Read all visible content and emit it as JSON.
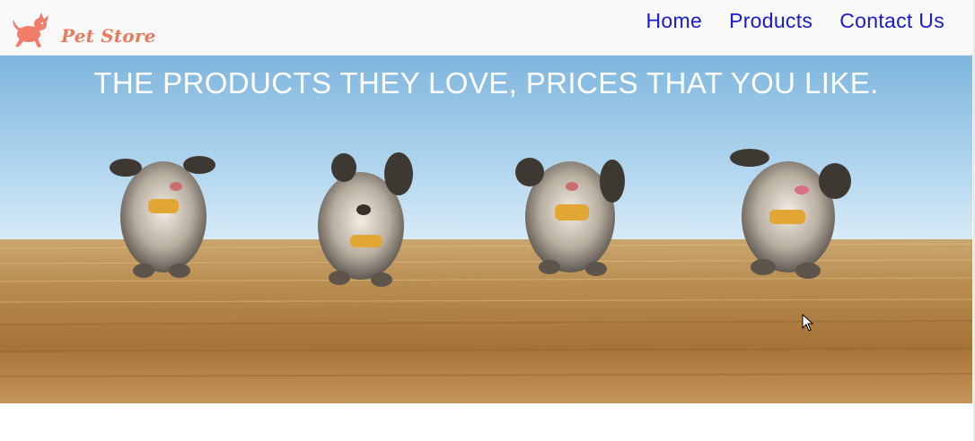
{
  "brand": {
    "name": "Pet Store",
    "logo_icon": "dog-logo-icon",
    "color": "#e97a5e"
  },
  "nav": {
    "items": [
      {
        "label": "Home"
      },
      {
        "label": "Products"
      },
      {
        "label": "Contact Us"
      }
    ],
    "link_color": "#1a1ad6"
  },
  "hero": {
    "title": "THE PRODUCTS THEY LOVE, PRICES THAT YOU LIKE.",
    "image": "four-dogs-running-in-field"
  }
}
